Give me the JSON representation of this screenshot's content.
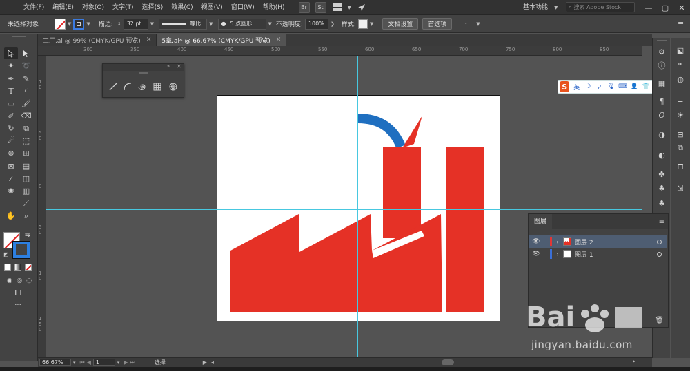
{
  "menubar": {
    "items": [
      "文件(F)",
      "编辑(E)",
      "对象(O)",
      "文字(T)",
      "选择(S)",
      "效果(C)",
      "视图(V)",
      "窗口(W)",
      "帮助(H)"
    ],
    "bridge_label": "Br",
    "stock_label": "St",
    "workspace": "基本功能",
    "search_placeholder": "搜索 Adobe Stock"
  },
  "control_bar": {
    "selection_status": "未选择对象",
    "stroke_label": "描边:",
    "stroke_weight": "32 pt",
    "profile": "等比",
    "brush": "5 点圆形",
    "opacity_label": "不透明度:",
    "opacity_value": "100%",
    "style_label": "样式:",
    "doc_setup_label": "文档设置",
    "preferences_label": "首选项"
  },
  "tabs": [
    {
      "label": "工厂.ai @ 99% (CMYK/GPU 预览)",
      "active": false
    },
    {
      "label": "5章.ai* @ 66.67% (CMYK/GPU 预览)",
      "active": true
    }
  ],
  "ruler": {
    "top_labels": [
      "300",
      "350",
      "400",
      "450",
      "500",
      "550",
      "600",
      "650",
      "700",
      "750",
      "800",
      "850"
    ],
    "left_labels": [
      "1 0",
      "5 0",
      "0",
      "5 0",
      "1 0",
      "1 5 0"
    ]
  },
  "layers_panel": {
    "title": "图层",
    "layers": [
      {
        "name": "图层 2",
        "color": "#e23636",
        "selected": true
      },
      {
        "name": "图层 1",
        "color": "#3b6fd6",
        "selected": false
      }
    ]
  },
  "status_bar": {
    "zoom": "66.67%",
    "artboard_number": "1",
    "tool_status": "选择"
  },
  "ime": {
    "mode_label": "英"
  },
  "watermark": {
    "text": "jingyan.baidu.com"
  },
  "colors": {
    "factory_red": "#e53126",
    "smoke_blue": "#1f6fc0",
    "guide_cyan": "#47c8e0",
    "selection_blue": "#4e5d72"
  }
}
